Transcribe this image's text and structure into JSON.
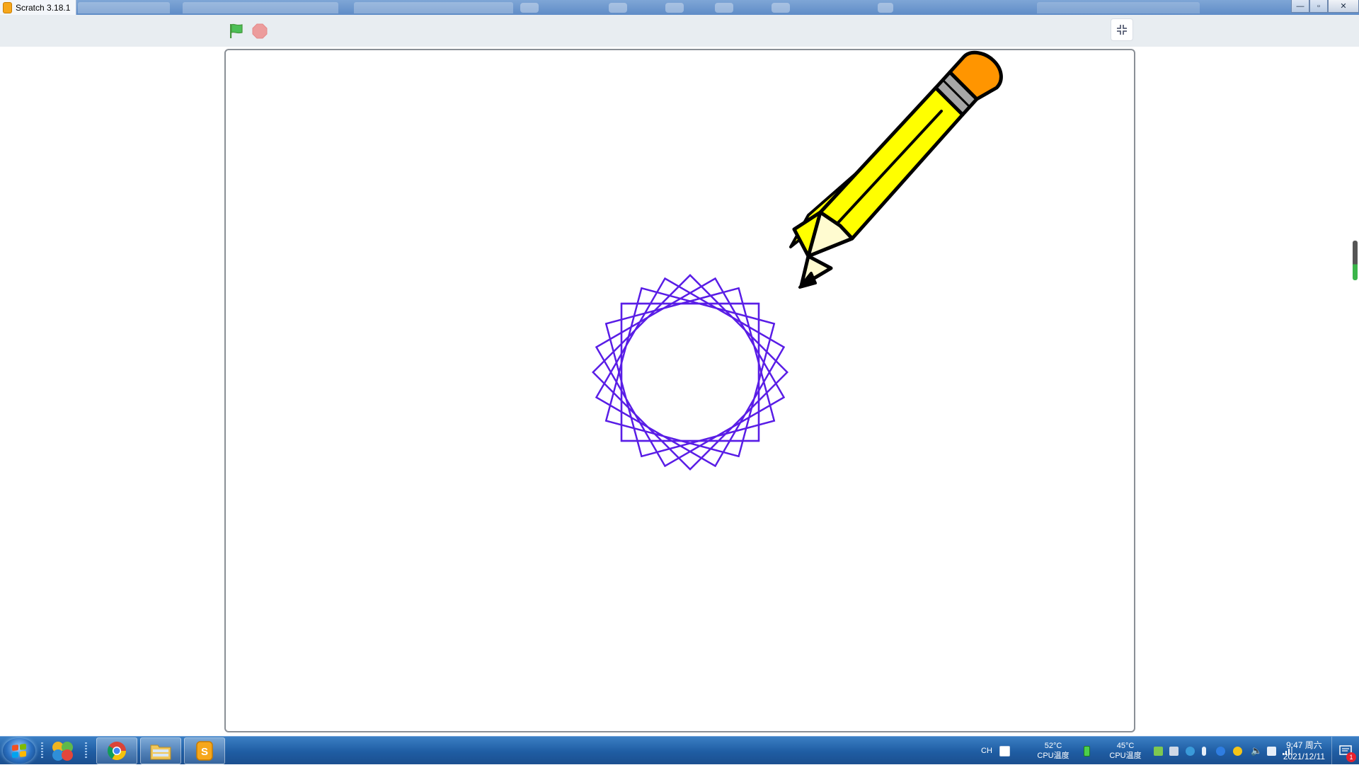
{
  "window": {
    "title": "Scratch 3.18.1",
    "buttons": {
      "minimize": "—",
      "maximize": "▫",
      "close": "✕"
    }
  },
  "controls": {
    "green_flag_icon": "green-flag-icon",
    "stop_icon": "stop-sign-icon",
    "fullscreen_icon": "unfullscreen-icon"
  },
  "stage": {
    "pen_color": "#5a1ee6",
    "sprite": "pencil",
    "drawing": "spirograph star pattern"
  },
  "taskbar": {
    "pinned": [
      "start-orb",
      "media-app",
      "chrome",
      "file-explorer",
      "scratch"
    ],
    "tray": {
      "language": "CH",
      "cpu1_temp": "52°C",
      "cpu1_label": "CPU温度",
      "cpu2_temp": "45°C",
      "cpu2_label": "CPU温度",
      "time": "9:47 周六",
      "date": "2021/12/11",
      "notification_count": "1"
    }
  }
}
